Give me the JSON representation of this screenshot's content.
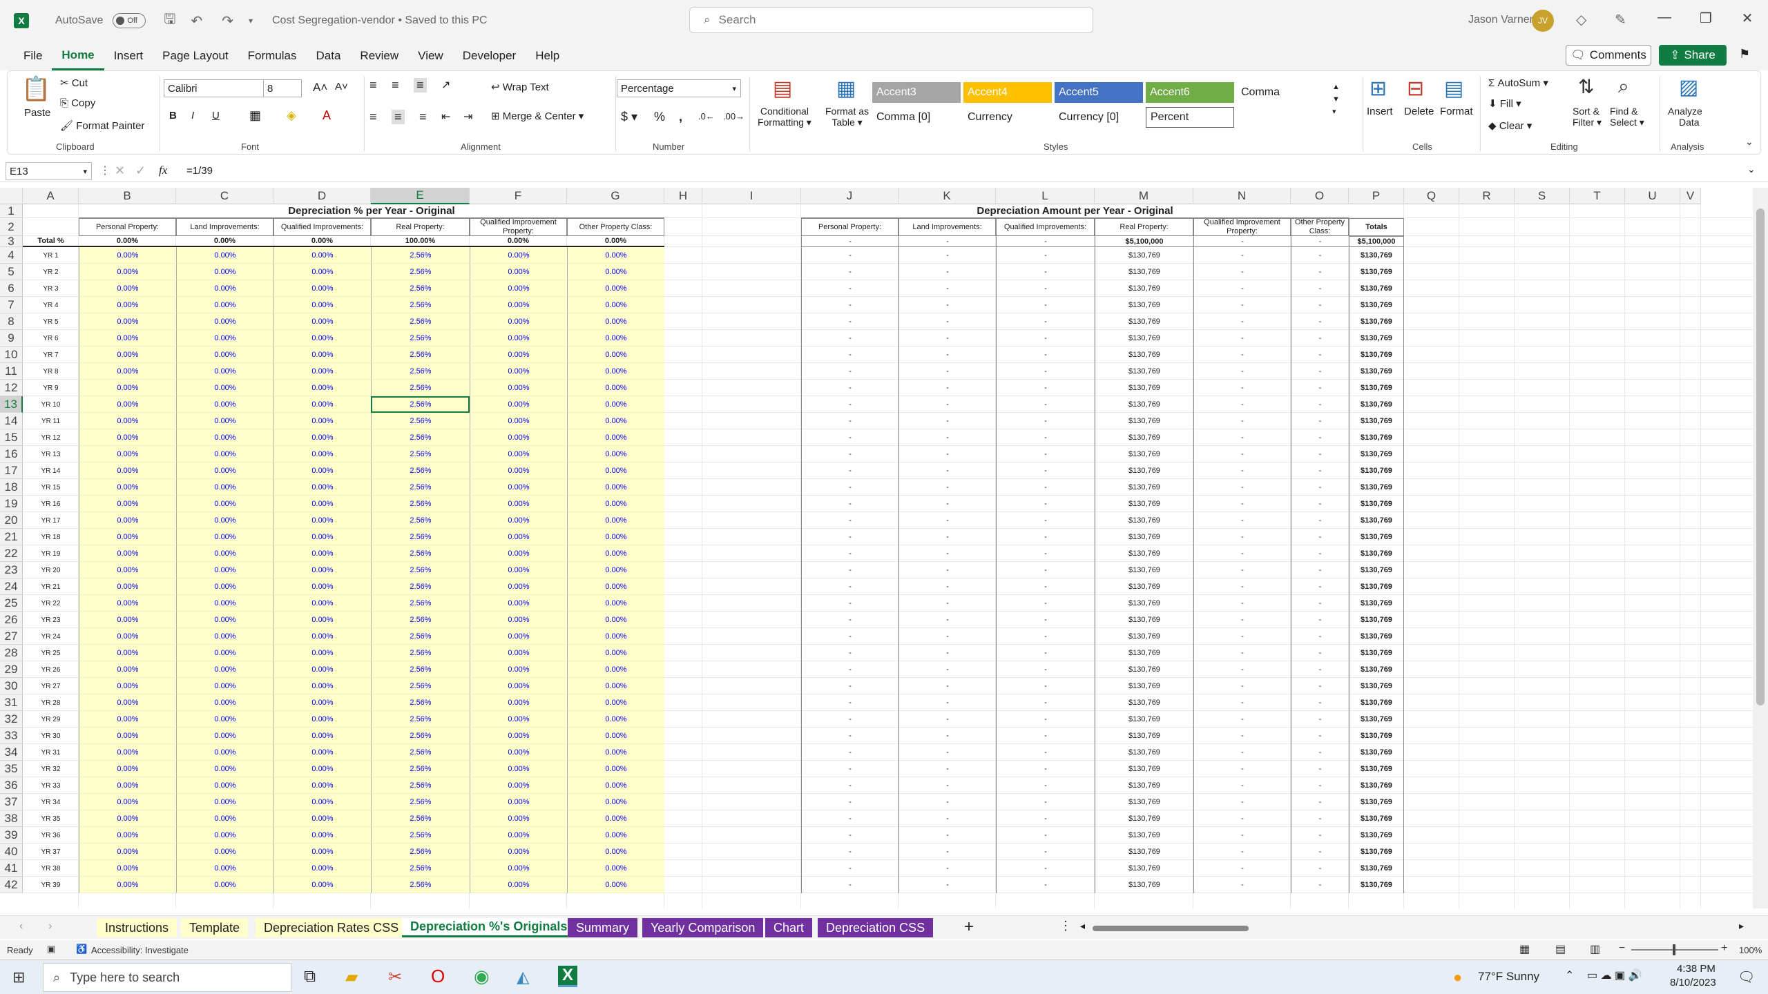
{
  "titlebar": {
    "autosave": "AutoSave",
    "toggle": "Off",
    "doc_title": "Cost Segregation-vendor • Saved to this PC",
    "search_placeholder": "Search",
    "user": "Jason Varner",
    "initials": "JV"
  },
  "menu": [
    "File",
    "Home",
    "Insert",
    "Page Layout",
    "Formulas",
    "Data",
    "Review",
    "View",
    "Developer",
    "Help"
  ],
  "comments": "Comments",
  "share": "Share",
  "ribbon": {
    "paste": "Paste",
    "cut": "Cut",
    "copy": "Copy",
    "format_painter": "Format Painter",
    "clipboard": "Clipboard",
    "font_name": "Calibri",
    "font_size": "8",
    "font": "Font",
    "wrap_text": "Wrap Text",
    "merge_center": "Merge & Center",
    "alignment": "Alignment",
    "number_format": "Percentage",
    "number": "Number",
    "cond_fmt_1": "Conditional",
    "cond_fmt_2": "Formatting",
    "fmt_table_1": "Format as",
    "fmt_table_2": "Table",
    "styles_label": "Styles",
    "accent3": "Accent3",
    "accent4": "Accent4",
    "accent5": "Accent5",
    "accent6": "Accent6",
    "comma": "Comma",
    "comma0": "Comma [0]",
    "currency": "Currency",
    "currency0": "Currency [0]",
    "percent": "Percent",
    "insert": "Insert",
    "delete": "Delete",
    "format": "Format",
    "cells": "Cells",
    "autosum": "AutoSum",
    "fill": "Fill",
    "clear": "Clear",
    "sort_1": "Sort &",
    "sort_2": "Filter",
    "find_1": "Find &",
    "find_2": "Select",
    "editing": "Editing",
    "analyze_1": "Analyze",
    "analyze_2": "Data",
    "analysis": "Analysis"
  },
  "formula": {
    "namebox": "E13",
    "fx": "fx",
    "value": "=1/39"
  },
  "columns": [
    "A",
    "B",
    "C",
    "D",
    "E",
    "F",
    "G",
    "H",
    "I",
    "J",
    "K",
    "L",
    "M",
    "N",
    "O",
    "P",
    "Q",
    "R",
    "S",
    "T",
    "U",
    "V"
  ],
  "sheet": {
    "title_left": "Depreciation % per Year - Original",
    "title_right": "Depreciation Amount per Year - Original",
    "headers": [
      "Personal Property:",
      "Land Improvements:",
      "Qualified Improvements:",
      "Real Property:",
      "Qualified Improvement Property:",
      "Other Property Class:"
    ],
    "totals_header": "Totals",
    "total_label": "Total %",
    "total_pct": [
      "0.00%",
      "0.00%",
      "0.00%",
      "100.00%",
      "0.00%",
      "0.00%"
    ],
    "total_amt": [
      "-",
      "-",
      "-",
      "$5,100,000",
      "-",
      "-",
      "$5,100,000"
    ],
    "year_pct": [
      "0.00%",
      "0.00%",
      "0.00%",
      "2.56%",
      "0.00%",
      "0.00%"
    ],
    "year_amt": [
      "-",
      "-",
      "-",
      "$130,769",
      "-",
      "-",
      "$130,769"
    ],
    "years": [
      "YR 1",
      "YR 2",
      "YR 3",
      "YR 4",
      "YR 5",
      "YR 6",
      "YR 7",
      "YR 8",
      "YR 9",
      "YR 10",
      "YR 11",
      "YR 12",
      "YR 13",
      "YR 14",
      "YR 15",
      "YR 16",
      "YR 17",
      "YR 18",
      "YR 19",
      "YR 20",
      "YR 21",
      "YR 22",
      "YR 23",
      "YR 24",
      "YR 25",
      "YR 26",
      "YR 27",
      "YR 28",
      "YR 29",
      "YR 30",
      "YR 31",
      "YR 32",
      "YR 33",
      "YR 34",
      "YR 35",
      "YR 36",
      "YR 37",
      "YR 38",
      "YR 39"
    ]
  },
  "tabs": [
    "Instructions",
    "Template",
    "Depreciation Rates CSS",
    "Depreciation %'s Originals",
    "Summary",
    "Yearly Comparison",
    "Chart",
    "Depreciation CSS"
  ],
  "tab_add": "+",
  "status": {
    "ready": "Ready",
    "accessibility": "Accessibility: Investigate",
    "zoom": "100%"
  },
  "taskbar": {
    "search": "Type here to search",
    "weather": "77°F  Sunny",
    "time": "4:38 PM",
    "date": "8/10/2023"
  },
  "colors": {
    "excel_green": "#107c41",
    "yellow_fill": "#ffffcc",
    "blue_text": "#0000ff",
    "purple_tab": "#7030a0"
  }
}
